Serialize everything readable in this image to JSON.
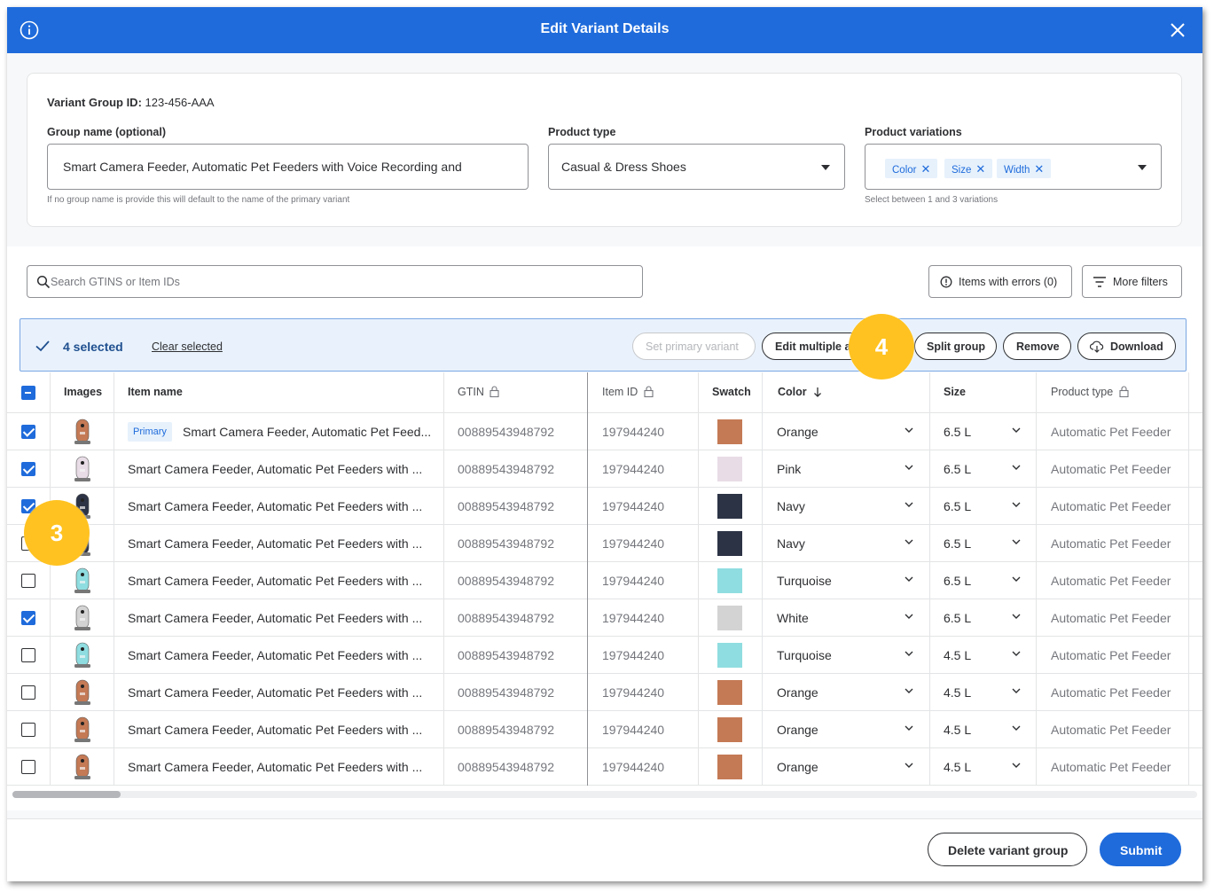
{
  "header": {
    "title": "Edit Variant Details"
  },
  "details": {
    "variant_group_id_label": "Variant Group ID:",
    "variant_group_id": "123-456-AAA",
    "group_name_label": "Group name (optional)",
    "group_name_value": "Smart Camera Feeder, Automatic Pet Feeders with Voice Recording and",
    "group_name_help": "If no group name is provide this will default to the name of the primary variant",
    "product_type_label": "Product type",
    "product_type_value": "Casual & Dress Shoes",
    "product_variations_label": "Product variations",
    "variation_chips": [
      "Color",
      "Size",
      "Width"
    ],
    "variations_help": "Select between 1 and 3 variations"
  },
  "toolbar": {
    "search_placeholder": "Search GTINS or Item IDs",
    "errors_button": "Items with errors (0)",
    "filters_button": "More filters"
  },
  "selection_bar": {
    "count_label": "4 selected",
    "clear_label": "Clear selected",
    "set_primary_label": "Set primary variant",
    "edit_multiple_label": "Edit multiple attributes",
    "split_group_label": "Split group",
    "remove_label": "Remove",
    "download_label": "Download"
  },
  "table": {
    "columns": {
      "images": "Images",
      "item_name": "Item name",
      "gtin": "GTIN",
      "item_id": "Item ID",
      "swatch": "Swatch",
      "color": "Color",
      "size": "Size",
      "product_type": "Product type"
    },
    "primary_tag": "Primary",
    "rows": [
      {
        "checked": true,
        "primary": true,
        "name": "Smart Camera Feeder, Automatic Pet Feed...",
        "gtin": "00889543948792",
        "item_id": "197944240",
        "swatch": "#c47a55",
        "color": "Orange",
        "size": "6.5 L",
        "product_type": "Automatic Pet Feeder"
      },
      {
        "checked": true,
        "primary": false,
        "name": "Smart Camera Feeder, Automatic Pet Feeders with ...",
        "gtin": "00889543948792",
        "item_id": "197944240",
        "swatch": "#e8dce6",
        "color": "Pink",
        "size": "6.5 L",
        "product_type": "Automatic Pet Feeder"
      },
      {
        "checked": true,
        "primary": false,
        "name": "Smart Camera Feeder, Automatic Pet Feeders with ...",
        "gtin": "00889543948792",
        "item_id": "197944240",
        "swatch": "#2c3345",
        "color": "Navy",
        "size": "6.5 L",
        "product_type": "Automatic Pet Feeder"
      },
      {
        "checked": false,
        "primary": false,
        "name": "Smart Camera Feeder, Automatic Pet Feeders with ...",
        "gtin": "00889543948792",
        "item_id": "197944240",
        "swatch": "#2c3345",
        "color": "Navy",
        "size": "6.5 L",
        "product_type": "Automatic Pet Feeder"
      },
      {
        "checked": false,
        "primary": false,
        "name": "Smart Camera Feeder, Automatic Pet Feeders with ...",
        "gtin": "00889543948792",
        "item_id": "197944240",
        "swatch": "#8fdde0",
        "color": "Turquoise",
        "size": "6.5 L",
        "product_type": "Automatic Pet Feeder"
      },
      {
        "checked": true,
        "primary": false,
        "name": "Smart Camera Feeder, Automatic Pet Feeders with ...",
        "gtin": "00889543948792",
        "item_id": "197944240",
        "swatch": "#d3d3d3",
        "color": "White",
        "size": "6.5 L",
        "product_type": "Automatic Pet Feeder"
      },
      {
        "checked": false,
        "primary": false,
        "name": "Smart Camera Feeder, Automatic Pet Feeders with ...",
        "gtin": "00889543948792",
        "item_id": "197944240",
        "swatch": "#8fdde0",
        "color": "Turquoise",
        "size": "4.5 L",
        "product_type": "Automatic Pet Feeder"
      },
      {
        "checked": false,
        "primary": false,
        "name": "Smart Camera Feeder, Automatic Pet Feeders with ...",
        "gtin": "00889543948792",
        "item_id": "197944240",
        "swatch": "#c47a55",
        "color": "Orange",
        "size": "4.5 L",
        "product_type": "Automatic Pet Feeder"
      },
      {
        "checked": false,
        "primary": false,
        "name": "Smart Camera Feeder, Automatic Pet Feeders with ...",
        "gtin": "00889543948792",
        "item_id": "197944240",
        "swatch": "#c47a55",
        "color": "Orange",
        "size": "4.5 L",
        "product_type": "Automatic Pet Feeder"
      },
      {
        "checked": false,
        "primary": false,
        "name": "Smart Camera Feeder, Automatic Pet Feeders with ...",
        "gtin": "00889543948792",
        "item_id": "197944240",
        "swatch": "#c47a55",
        "color": "Orange",
        "size": "4.5 L",
        "product_type": "Automatic Pet Feeder"
      }
    ]
  },
  "footer": {
    "delete_label": "Delete variant group",
    "submit_label": "Submit"
  },
  "callouts": [
    "3",
    "4"
  ]
}
